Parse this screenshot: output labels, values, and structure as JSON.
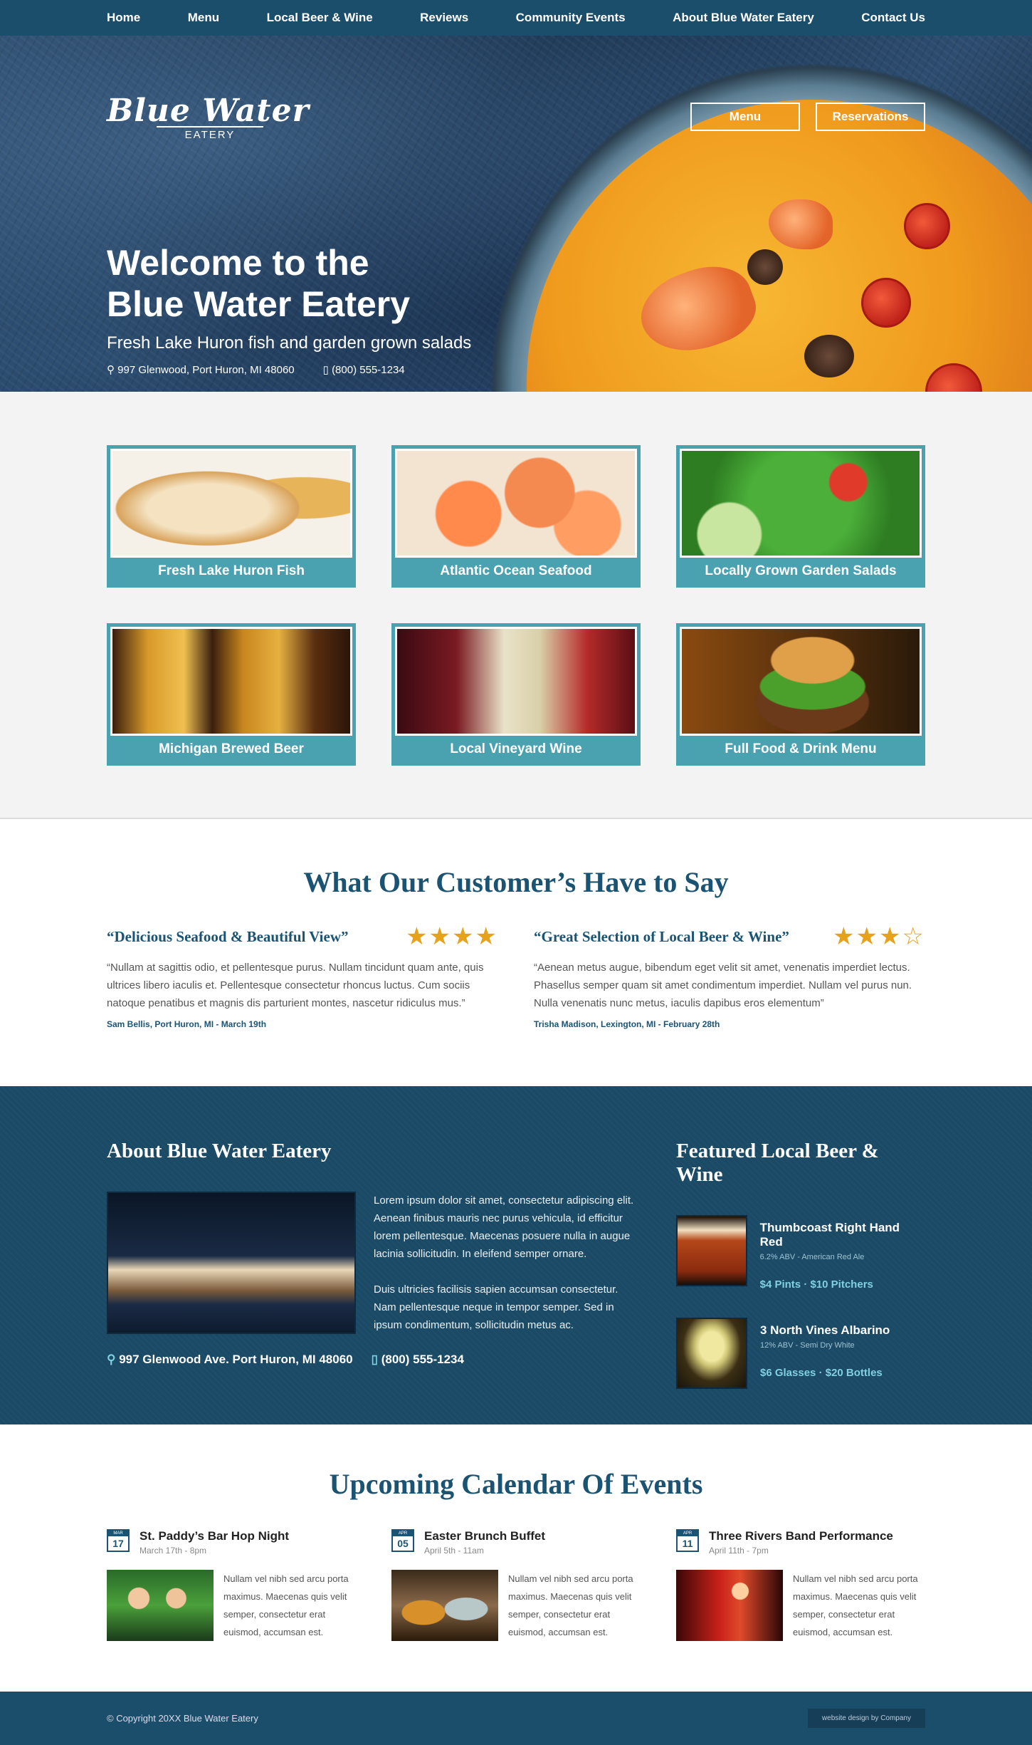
{
  "nav": {
    "items": [
      "Home",
      "Menu",
      "Local Beer & Wine",
      "Reviews",
      "Community Events",
      "About Blue Water Eatery",
      "Contact Us"
    ]
  },
  "hero": {
    "logo_script": "Blue Water",
    "logo_sub": "EATERY",
    "btn_menu": "Menu",
    "btn_reservations": "Reservations",
    "title_line1": "Welcome to the",
    "title_line2": "Blue Water Eatery",
    "tagline": "Fresh Lake Huron fish and garden grown salads",
    "address": "997 Glenwood, Port Huron, MI 48060",
    "phone": "(800) 555-1234"
  },
  "tiles": [
    {
      "caption": "Fresh Lake Huron Fish"
    },
    {
      "caption": "Atlantic Ocean Seafood"
    },
    {
      "caption": "Locally Grown Garden Salads"
    },
    {
      "caption": "Michigan Brewed Beer"
    },
    {
      "caption": "Local Vineyard Wine"
    },
    {
      "caption": "Full Food & Drink Menu"
    }
  ],
  "reviews": {
    "title": "What Our Customer’s Have to Say",
    "items": [
      {
        "quote": "“Delicious Seafood & Beautiful View”",
        "stars": "★★★★",
        "body": "“Nullam at sagittis odio, et pellentesque purus. Nullam tincidunt quam ante, quis ultrices libero iaculis et. Pellentesque consectetur rhoncus luctus. Cum sociis natoque penatibus et magnis dis parturient montes, nascetur ridiculus mus.”",
        "author": "Sam Bellis, Port Huron, MI - March 19th"
      },
      {
        "quote": "“Great Selection of Local Beer & Wine”",
        "stars": "★★★☆",
        "body": "“Aenean metus augue, bibendum eget velit sit amet, venenatis imperdiet lectus. Phasellus semper quam sit amet condimentum imperdiet. Nullam vel purus nun. Nulla venenatis nunc metus, iaculis dapibus eros elementum”",
        "author": "Trisha Madison, Lexington, MI - February 28th"
      }
    ]
  },
  "about": {
    "title": "About Blue Water Eatery",
    "para1": "Lorem ipsum dolor sit amet, consectetur adipiscing elit. Aenean finibus mauris nec purus vehicula, id efficitur lorem pellentesque. Maecenas posuere nulla in augue lacinia sollicitudin. In eleifend semper ornare.",
    "para2": "Duis ultricies facilisis sapien accumsan consectetur. Nam pellentesque neque in tempor semper. Sed in ipsum condimentum, sollicitudin metus ac.",
    "address": "997 Glenwood Ave. Port Huron, MI 48060",
    "phone": "(800) 555-1234"
  },
  "featured": {
    "title": "Featured Local Beer & Wine",
    "items": [
      {
        "name": "Thumbcoast Right Hand Red",
        "meta": "6.2% ABV - American Red Ale",
        "price": "$4 Pints  · $10 Pitchers"
      },
      {
        "name": "3 North Vines Albarino",
        "meta": "12% ABV - Semi Dry White",
        "price": "$6 Glasses  · $20 Bottles"
      }
    ]
  },
  "events": {
    "title": "Upcoming Calendar Of Events",
    "items": [
      {
        "month": "MAR",
        "day": "17",
        "title": "St. Paddy’s Bar Hop Night",
        "date": "March 17th - 8pm",
        "body": "Nullam vel nibh sed arcu porta maximus. Maecenas quis velit semper, consectetur erat euismod, accumsan est."
      },
      {
        "month": "APR",
        "day": "05",
        "title": "Easter Brunch Buffet",
        "date": "April 5th - 11am",
        "body": "Nullam vel nibh sed arcu porta maximus. Maecenas quis velit semper, consectetur erat euismod, accumsan est."
      },
      {
        "month": "APR",
        "day": "11",
        "title": "Three Rivers Band Performance",
        "date": "April 11th - 7pm",
        "body": "Nullam vel nibh sed arcu porta maximus. Maecenas quis velit semper, consectetur erat euismod, accumsan est."
      }
    ]
  },
  "footer": {
    "copyright": "© Copyright 20XX Blue Water Eatery",
    "credit": "website design by Company"
  },
  "colors": {
    "nav": "#1b4e6b",
    "tile": "#4aa1b0",
    "heading": "#1b5373",
    "star": "#e6a21a"
  }
}
